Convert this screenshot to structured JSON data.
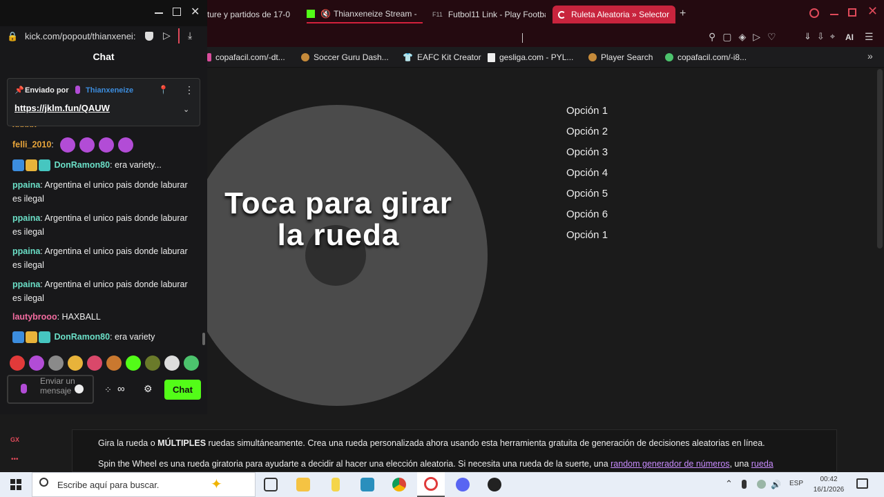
{
  "popout": {
    "url": "kick.com/popout/thianxenei:",
    "title": "Chat",
    "pinned": {
      "sender_prefix": "Enviado por",
      "sender": "Thianxeneize",
      "link": "https://jklm.fun/QAUW"
    },
    "messages": [
      {
        "user": "felli_2010",
        "text": ""
      },
      {
        "user": "DonRamon80",
        "text": ": era variety..."
      },
      {
        "user": "ppaina",
        "text": ": Argentina el unico pais donde laburar es ilegal"
      },
      {
        "user": "ppaina",
        "text": ": Argentina el unico pais donde laburar es ilegal"
      },
      {
        "user": "ppaina",
        "text": ": Argentina el unico pais donde laburar es ilegal"
      },
      {
        "user": "ppaina",
        "text": ": Argentina el unico pais donde laburar es ilegal"
      },
      {
        "user": "lautybrooo",
        "text": ": HAXBALL"
      },
      {
        "user": "DonRamon80",
        "text": ": era variety"
      }
    ],
    "input_placeholder": "Enviar un mensaje",
    "chat_button": "Chat",
    "colors": {
      "kick_green": "#53fc18",
      "user_teal": "#6be0c8",
      "user_orange": "#e8a53a",
      "user_pink": "#f36ca0"
    }
  },
  "tabs": [
    {
      "label": "ture y partidos de 17-0"
    },
    {
      "label": "Thianxeneize Stream -"
    },
    {
      "label": "Futbol11 Link - Play Footba"
    },
    {
      "label": "Ruleta Aleatoria » Selector"
    }
  ],
  "bookmarks": [
    {
      "label": "copafacil.com/-dt..."
    },
    {
      "label": "Soccer Guru Dash..."
    },
    {
      "label": "EAFC Kit Creator"
    },
    {
      "label": "gesliga.com - PYL..."
    },
    {
      "label": "Player Search"
    },
    {
      "label": "copafacil.com/-i8..."
    }
  ],
  "wheel": {
    "prompt_line1": "Toca para girar",
    "prompt_line2": "la rueda",
    "options": [
      "Opción 1",
      "Opción 2",
      "Opción 3",
      "Opción 4",
      "Opción 5",
      "Opción 6",
      "Opción 1"
    ]
  },
  "description": {
    "line1_a": "Gira la rueda o ",
    "line1_bold": "MÚLTIPLES",
    "line1_b": " ruedas simultáneamente. Crea una rueda personalizada ahora usando esta herramienta gratuita de generación de decisiones aleatorias en línea.",
    "line2_a": "Spin the Wheel es una rueda giratoria para ayudarte a decidir al hacer una elección aleatoria. Si necesita una rueda de la suerte, una ",
    "line2_link1": "random generador de números",
    "line2_b": ", una ",
    "line2_link2": "rueda"
  },
  "sidebar_gx": "GX",
  "taskbar": {
    "search_placeholder": "Escribe aquí para buscar.",
    "lang": "ESP",
    "time": "00:42",
    "date": "16/1/2026"
  }
}
